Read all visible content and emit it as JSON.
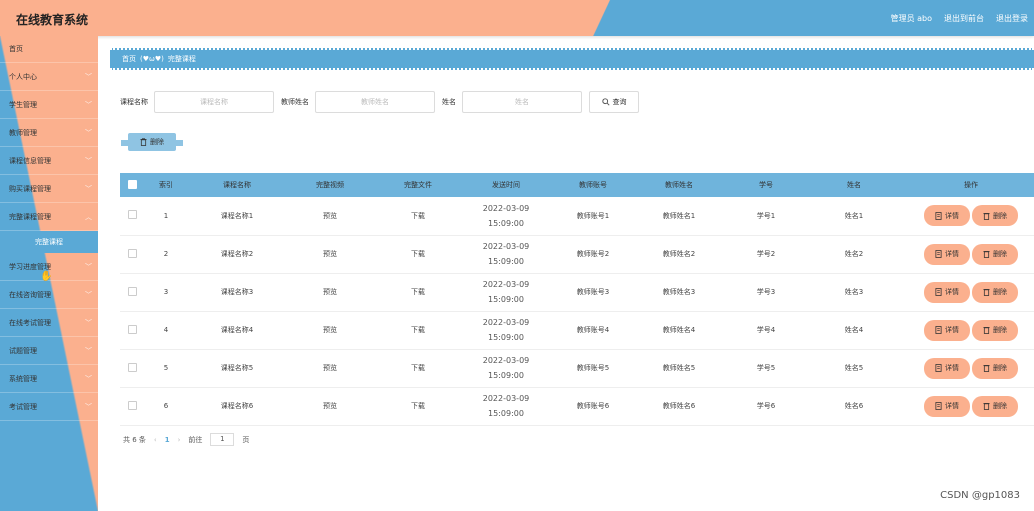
{
  "header": {
    "title": "在线教育系统",
    "admin": "管理员 abo",
    "back": "退出到前台",
    "logout": "退出登录"
  },
  "sidebar": {
    "items": [
      {
        "label": "首页",
        "chev": ""
      },
      {
        "label": "个人中心",
        "chev": "﹀"
      },
      {
        "label": "学生管理",
        "chev": "﹀"
      },
      {
        "label": "教师管理",
        "chev": "﹀"
      },
      {
        "label": "课程信息管理",
        "chev": "﹀"
      },
      {
        "label": "购买课程管理",
        "chev": "﹀"
      },
      {
        "label": "完整课程管理",
        "chev": "︿"
      }
    ],
    "active_sub": "完整课程",
    "items_after": [
      {
        "label": "学习进度管理",
        "chev": "﹀"
      },
      {
        "label": "在线咨询管理",
        "chev": "﹀"
      },
      {
        "label": "在线考试管理",
        "chev": "﹀"
      },
      {
        "label": "试题管理",
        "chev": "﹀"
      },
      {
        "label": "系统管理",
        "chev": "﹀"
      },
      {
        "label": "考试管理",
        "chev": "﹀"
      }
    ]
  },
  "breadcrumb": {
    "home": "首页",
    "sep": "(♥ω♥)",
    "current": "完整课程"
  },
  "search": {
    "course_label": "课程名称",
    "course_placeholder": "课程名称",
    "teacher_label": "教师姓名",
    "teacher_placeholder": "教师姓名",
    "name_label": "姓名",
    "name_placeholder": "姓名",
    "button": "查询"
  },
  "toolbar": {
    "delete": "删除"
  },
  "table": {
    "headers": [
      "索引",
      "课程名称",
      "完整视频",
      "完整文件",
      "发送时间",
      "教师账号",
      "教师姓名",
      "学号",
      "姓名",
      "操作"
    ],
    "rows": [
      {
        "idx": "1",
        "course": "课程名称1",
        "video": "预览",
        "file": "下载",
        "time": "2022-03-09 15:09:00",
        "acct": "教师账号1",
        "teacher": "教师姓名1",
        "sno": "学号1",
        "name": "姓名1"
      },
      {
        "idx": "2",
        "course": "课程名称2",
        "video": "预览",
        "file": "下载",
        "time": "2022-03-09 15:09:00",
        "acct": "教师账号2",
        "teacher": "教师姓名2",
        "sno": "学号2",
        "name": "姓名2"
      },
      {
        "idx": "3",
        "course": "课程名称3",
        "video": "预览",
        "file": "下载",
        "time": "2022-03-09 15:09:00",
        "acct": "教师账号3",
        "teacher": "教师姓名3",
        "sno": "学号3",
        "name": "姓名3"
      },
      {
        "idx": "4",
        "course": "课程名称4",
        "video": "预览",
        "file": "下载",
        "time": "2022-03-09 15:09:00",
        "acct": "教师账号4",
        "teacher": "教师姓名4",
        "sno": "学号4",
        "name": "姓名4"
      },
      {
        "idx": "5",
        "course": "课程名称5",
        "video": "预览",
        "file": "下载",
        "time": "2022-03-09 15:09:00",
        "acct": "教师账号5",
        "teacher": "教师姓名5",
        "sno": "学号5",
        "name": "姓名5"
      },
      {
        "idx": "6",
        "course": "课程名称6",
        "video": "预览",
        "file": "下载",
        "time": "2022-03-09 15:09:00",
        "acct": "教师账号6",
        "teacher": "教师姓名6",
        "sno": "学号6",
        "name": "姓名6"
      }
    ],
    "detail_label": "详情",
    "delete_label": "删除"
  },
  "pager": {
    "total": "共 6 条",
    "current": "1",
    "goto": "前往",
    "page_value": "1",
    "page_unit": "页"
  },
  "watermark": "CSDN @gp1083",
  "colors": {
    "peach": "#fbb08e",
    "blue": "#5aa9d6"
  },
  "icons": [
    "search-icon",
    "trash-icon",
    "detail-icon",
    "chevron-down-icon",
    "chevron-left-icon",
    "chevron-right-icon",
    "cursor-icon"
  ]
}
